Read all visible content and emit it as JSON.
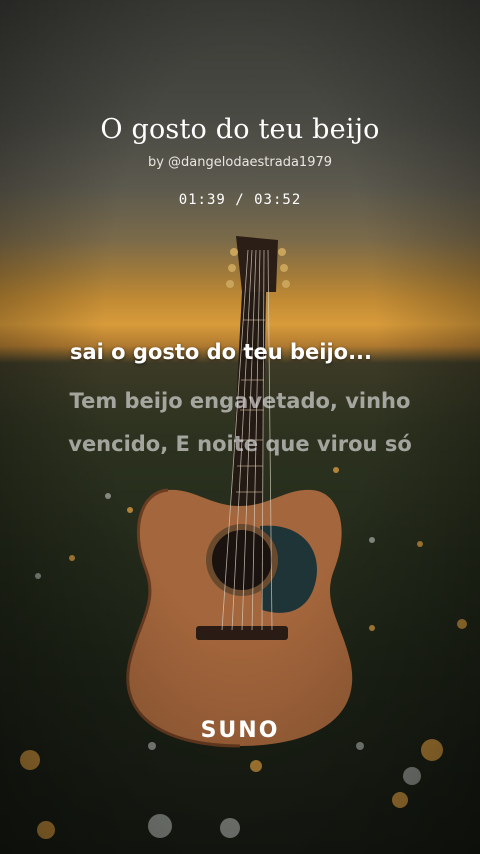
{
  "song": {
    "title": "O gosto do teu beijo",
    "author": "by @dangelodaestrada1979",
    "time_display": "01:39 / 03:52"
  },
  "lyrics": {
    "current_line": "sai o gosto do teu beijo...",
    "next_lines": "Tem beijo engavetado, vinho vencido, E noite que virou só"
  },
  "brand": {
    "logo_text": "SUNO"
  },
  "visuals": {
    "background": "sunset-field",
    "illustration": "acoustic-guitar",
    "colors": {
      "text": "#ffffff",
      "sky_glow": "#d89b3a",
      "guitar_wood": "#a4663c"
    }
  }
}
